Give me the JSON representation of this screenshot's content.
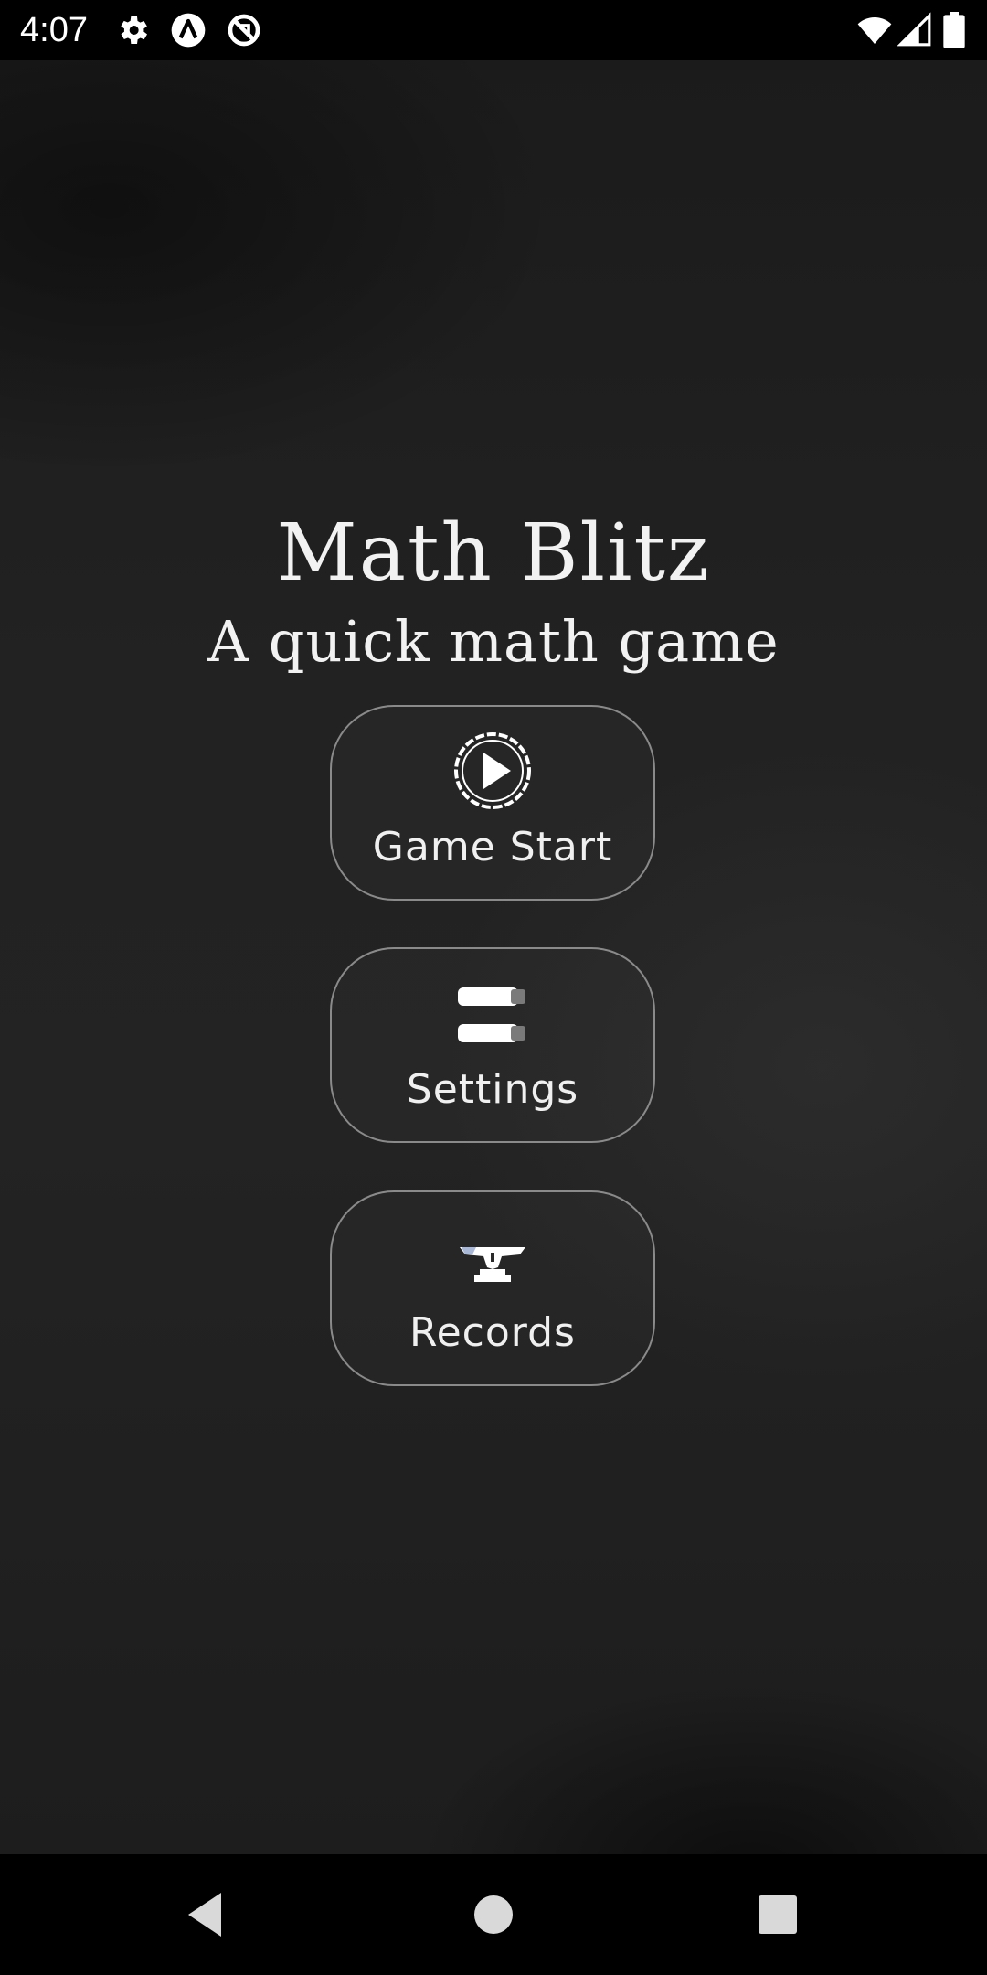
{
  "status_bar": {
    "time": "4:07",
    "icons": [
      "gear-icon",
      "app-a-icon",
      "no-sync-icon",
      "wifi-icon",
      "signal-icon",
      "battery-icon"
    ]
  },
  "title": "Math Blitz",
  "subtitle": "A quick math game",
  "menu": {
    "game_start": {
      "label": "Game Start",
      "icon": "play-circle-icon"
    },
    "settings": {
      "label": "Settings",
      "icon": "toggles-icon"
    },
    "records": {
      "label": "Records",
      "icon": "trophy-icon"
    }
  },
  "nav_bar": {
    "icons": [
      "back-icon",
      "home-icon",
      "recents-icon"
    ]
  },
  "colors": {
    "board": "#222222",
    "chalk": "#f2f2f2",
    "button_border": "#8a8a8a",
    "bars": "#000000"
  }
}
